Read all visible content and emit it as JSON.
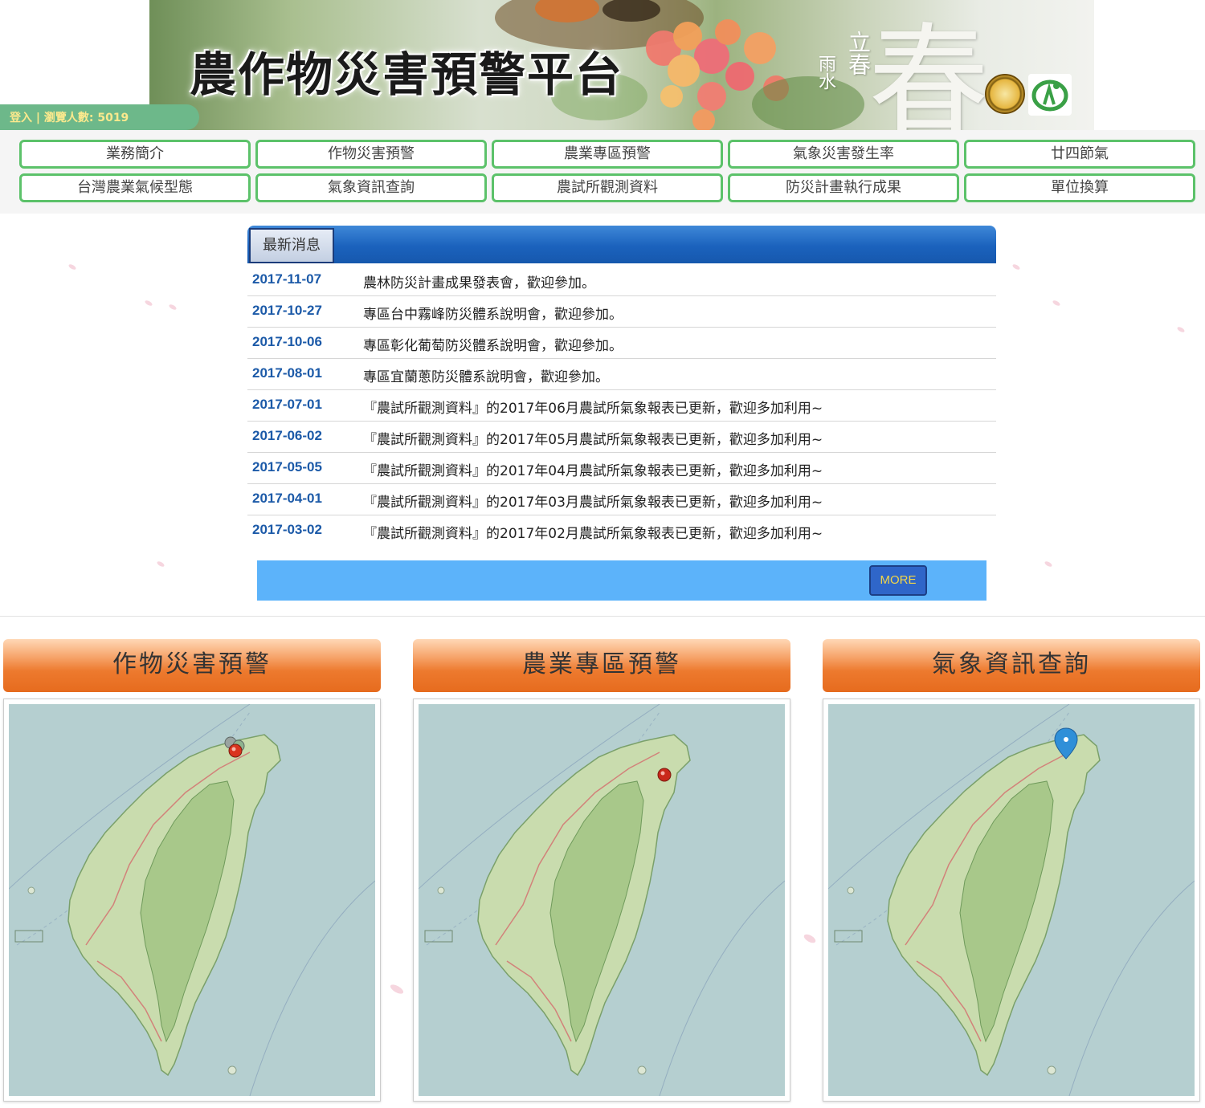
{
  "banner": {
    "title": "農作物災害預警平台",
    "spring_glyph": "春",
    "small_text_1": "立春",
    "small_text_2": "雨水"
  },
  "login": {
    "text": "登入 | 瀏覽人數: 5019"
  },
  "nav": {
    "items": [
      {
        "label": "業務簡介"
      },
      {
        "label": "作物災害預警"
      },
      {
        "label": "農業專區預警"
      },
      {
        "label": "氣象災害發生率"
      },
      {
        "label": "廿四節氣"
      },
      {
        "label": "台灣農業氣候型態"
      },
      {
        "label": "氣象資訊查詢"
      },
      {
        "label": "農試所觀測資料"
      },
      {
        "label": "防災計畫執行成果"
      },
      {
        "label": "單位換算"
      }
    ]
  },
  "news": {
    "tab_label": "最新消息",
    "items": [
      {
        "date": "2017-11-07",
        "title": "農林防災計畫成果發表會，歡迎參加。"
      },
      {
        "date": "2017-10-27",
        "title": "專區台中霧峰防災體系說明會，歡迎參加。"
      },
      {
        "date": "2017-10-06",
        "title": "專區彰化葡萄防災體系說明會，歡迎參加。"
      },
      {
        "date": "2017-08-01",
        "title": "專區宜蘭蔥防災體系說明會，歡迎參加。"
      },
      {
        "date": "2017-07-01",
        "title": "『農試所觀測資料』的2017年06月農試所氣象報表已更新，歡迎多加利用~"
      },
      {
        "date": "2017-06-02",
        "title": "『農試所觀測資料』的2017年05月農試所氣象報表已更新，歡迎多加利用~"
      },
      {
        "date": "2017-05-05",
        "title": "『農試所觀測資料』的2017年04月農試所氣象報表已更新，歡迎多加利用~"
      },
      {
        "date": "2017-04-01",
        "title": "『農試所觀測資料』的2017年03月農試所氣象報表已更新，歡迎多加利用~"
      },
      {
        "date": "2017-03-02",
        "title": "『農試所觀測資料』的2017年02月農試所氣象報表已更新，歡迎多加利用~"
      }
    ],
    "more_label": "MORE"
  },
  "panels": [
    {
      "title": "作物災害預警",
      "marker_color": "#d9341e"
    },
    {
      "title": "農業專區預警",
      "marker_color": "#c9281a"
    },
    {
      "title": "氣象資訊查詢",
      "marker_color": "#2f8fd8"
    }
  ],
  "colors": {
    "nav_border": "#5cc26a",
    "news_date": "#1c5aa8",
    "news_header": "#1b62bd",
    "more_bar": "#5cb3fa",
    "panel_header": "#ed7a2e",
    "map_sea": "#b5cfd0",
    "map_land": "#a8c88a"
  }
}
